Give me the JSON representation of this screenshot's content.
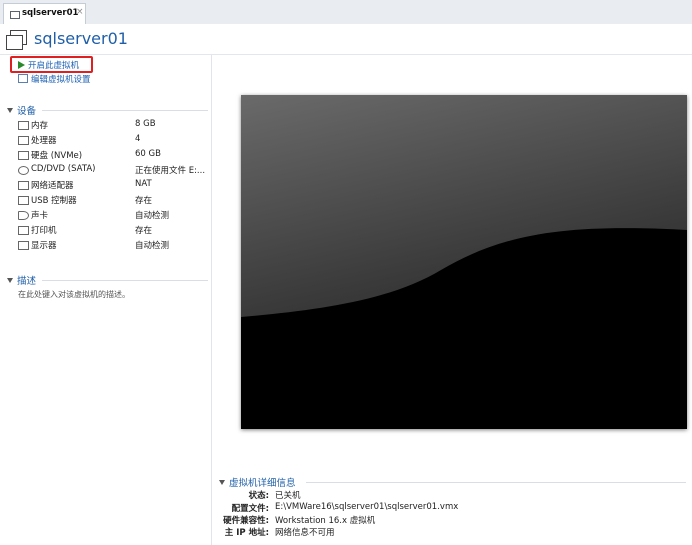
{
  "tab": {
    "label": "sqlserver01",
    "close": "×"
  },
  "header": {
    "title": "sqlserver01"
  },
  "actions": {
    "power_on": "开启此虚拟机",
    "edit_settings": "编辑虚拟机设置"
  },
  "devices": {
    "section_title": "设备",
    "items": [
      {
        "icon": "memory-icon",
        "name": "内存",
        "value": "8 GB"
      },
      {
        "icon": "processor-icon",
        "name": "处理器",
        "value": "4"
      },
      {
        "icon": "hard-disk-icon",
        "name": "硬盘 (NVMe)",
        "value": "60 GB"
      },
      {
        "icon": "cd-dvd-icon",
        "name": "CD/DVD (SATA)",
        "value": "正在使用文件 E:..."
      },
      {
        "icon": "network-adapter-icon",
        "name": "网络适配器",
        "value": "NAT"
      },
      {
        "icon": "usb-controller-icon",
        "name": "USB 控制器",
        "value": "存在"
      },
      {
        "icon": "sound-card-icon",
        "name": "声卡",
        "value": "自动检测"
      },
      {
        "icon": "printer-icon",
        "name": "打印机",
        "value": "存在"
      },
      {
        "icon": "display-icon",
        "name": "显示器",
        "value": "自动检测"
      }
    ]
  },
  "description": {
    "section_title": "描述",
    "placeholder": "在此处键入对该虚拟机的描述。"
  },
  "details": {
    "section_title": "虚拟机详细信息",
    "rows": [
      {
        "key": "状态:",
        "value": "已关机"
      },
      {
        "key": "配置文件:",
        "value": "E:\\VMWare16\\sqlserver01\\sqlserver01.vmx"
      },
      {
        "key": "硬件兼容性:",
        "value": "Workstation 16.x 虚拟机"
      },
      {
        "key": "主 IP 地址:",
        "value": "网络信息不可用"
      }
    ]
  },
  "colors": {
    "accent": "#1f5fa8",
    "highlight_border": "#e02020",
    "play_green": "#2a8a2a"
  }
}
